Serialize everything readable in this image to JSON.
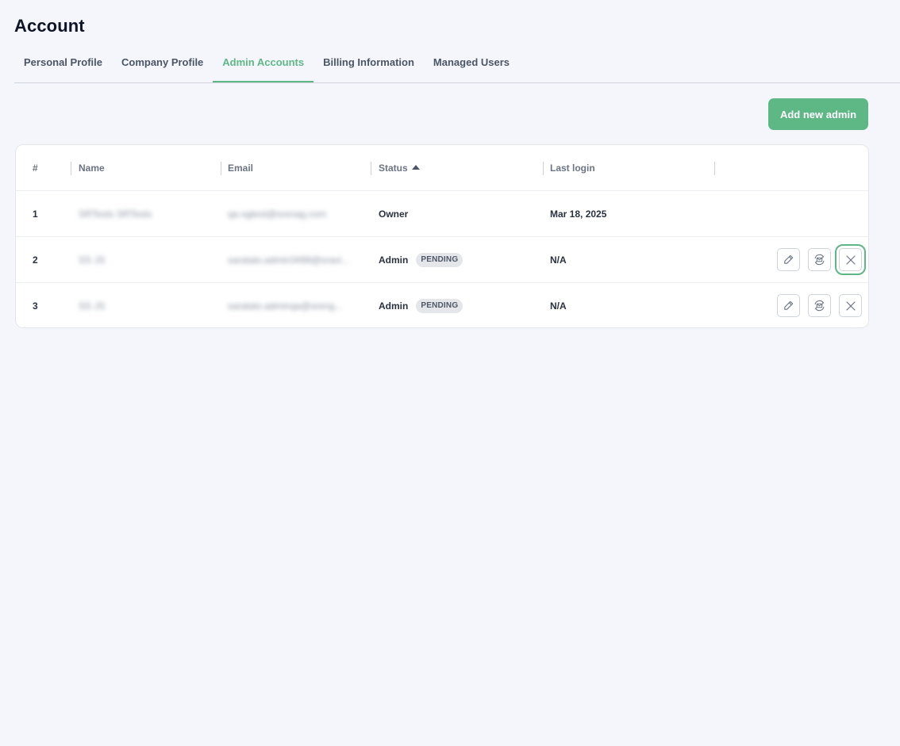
{
  "page": {
    "title": "Account"
  },
  "tabs": [
    {
      "label": "Personal Profile",
      "active": false
    },
    {
      "label": "Company Profile",
      "active": false
    },
    {
      "label": "Admin Accounts",
      "active": true
    },
    {
      "label": "Billing Information",
      "active": false
    },
    {
      "label": "Managed Users",
      "active": false
    }
  ],
  "actions": {
    "add_admin_label": "Add new admin"
  },
  "table": {
    "columns": {
      "num": "#",
      "name": "Name",
      "email": "Email",
      "status": "Status",
      "last_login": "Last login"
    },
    "sort": {
      "column": "Status",
      "direction": "ascending",
      "icon": "triangle-up-icon"
    },
    "rows": [
      {
        "num": "1",
        "name": "SRTests SRTests",
        "email": "qa-sgtest@srenag.com",
        "status": "Owner",
        "badge": "",
        "last_login": "Mar 18, 2025",
        "has_actions": false
      },
      {
        "num": "2",
        "name": "SS JS",
        "email": "saratalo.admin3498@sravi...",
        "status": "Admin",
        "badge": "PENDING",
        "last_login": "N/A",
        "has_actions": true
      },
      {
        "num": "3",
        "name": "SS JS",
        "email": "saratalo.adminqa@sreng...",
        "status": "Admin",
        "badge": "PENDING",
        "last_login": "N/A",
        "has_actions": true
      }
    ],
    "row_action_icons": [
      "pencil-icon",
      "resend-mail-icon",
      "close-icon"
    ]
  },
  "colors": {
    "accent": "#5db885",
    "background": "#f5f6fb",
    "title": "#0d1526",
    "badge_bg": "#e4e6ea"
  }
}
